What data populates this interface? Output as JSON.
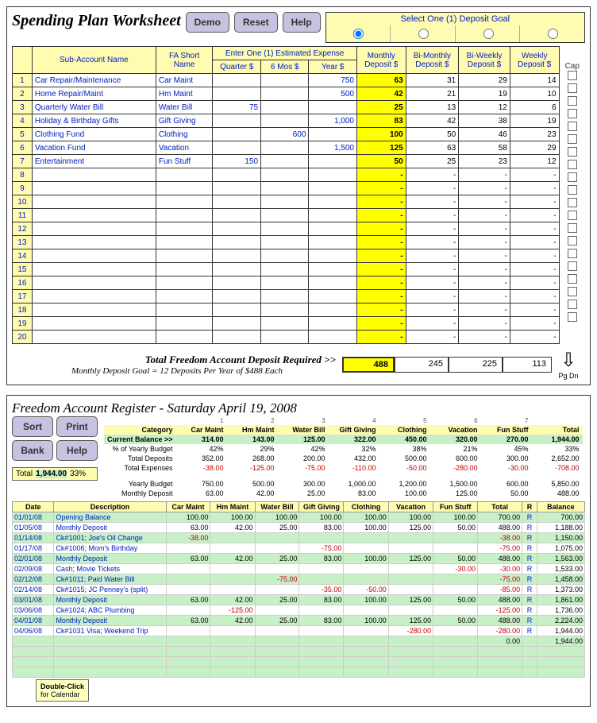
{
  "spending": {
    "title": "Spending Plan Worksheet",
    "demo": "Demo",
    "reset": "Reset",
    "help": "Help",
    "depgoal": "Select One (1) Deposit Goal",
    "hdr_sub": "Sub-Account Name",
    "hdr_fa": "FA Short Name",
    "hdr_exp": "Enter One (1) Estimated Expense",
    "hdr_q": "Quarter $",
    "hdr_6": "6 Mos $",
    "hdr_y": "Year $",
    "hdr_mon": "Monthly Deposit $",
    "hdr_bim": "Bi-Monthly Deposit $",
    "hdr_biw": "Bi-Weekly Deposit $",
    "hdr_wk": "Weekly Deposit $",
    "cap": "Cap",
    "rows": [
      {
        "n": "1",
        "name": "Car Repair/Maintenance",
        "fa": "Car Maint",
        "q": "",
        "s": "",
        "y": "750",
        "mon": "63",
        "bim": "31",
        "biw": "29",
        "wk": "14"
      },
      {
        "n": "2",
        "name": "Home Repair/Maint",
        "fa": "Hm Maint",
        "q": "",
        "s": "",
        "y": "500",
        "mon": "42",
        "bim": "21",
        "biw": "19",
        "wk": "10"
      },
      {
        "n": "3",
        "name": "Quarterly Water Bill",
        "fa": "Water Bill",
        "q": "75",
        "s": "",
        "y": "",
        "mon": "25",
        "bim": "13",
        "biw": "12",
        "wk": "6"
      },
      {
        "n": "4",
        "name": "Holiday & Birthday Gifts",
        "fa": "Gift Giving",
        "q": "",
        "s": "",
        "y": "1,000",
        "mon": "83",
        "bim": "42",
        "biw": "38",
        "wk": "19"
      },
      {
        "n": "5",
        "name": "Clothing Fund",
        "fa": "Clothing",
        "q": "",
        "s": "600",
        "y": "",
        "mon": "100",
        "bim": "50",
        "biw": "46",
        "wk": "23"
      },
      {
        "n": "6",
        "name": "Vacation Fund",
        "fa": "Vacation",
        "q": "",
        "s": "",
        "y": "1,500",
        "mon": "125",
        "bim": "63",
        "biw": "58",
        "wk": "29"
      },
      {
        "n": "7",
        "name": "Entertainment",
        "fa": "Fun Stuff",
        "q": "150",
        "s": "",
        "y": "",
        "mon": "50",
        "bim": "25",
        "biw": "23",
        "wk": "12"
      }
    ],
    "empty": [
      "8",
      "9",
      "10",
      "11",
      "12",
      "13",
      "14",
      "15",
      "16",
      "17",
      "18",
      "19",
      "20"
    ],
    "totreq": "Total Freedom Account Deposit Required  >>",
    "tot_mon": "488",
    "tot_bim": "245",
    "tot_biw": "225",
    "tot_wk": "113",
    "subtext": "Monthly Deposit Goal = 12 Deposits Per Year of $488 Each",
    "pgdn": "Pg Dn"
  },
  "register": {
    "title": "Freedom Account Register - Saturday April 19, 2008",
    "sort": "Sort",
    "print": "Print",
    "bank": "Bank",
    "help": "Help",
    "total_lbl": "Total",
    "total_val": "1,944.00",
    "total_pct": "33%",
    "lbl_cat": "Category",
    "lbl_cur": "Current Balance >>",
    "lbl_pct": "% of Yearly Budget",
    "lbl_td": "Total Deposits",
    "lbl_te": "Total Expenses",
    "lbl_yb": "Yearly Budget",
    "lbl_md": "Monthly Deposit",
    "cats": [
      "Car Maint",
      "Hm Maint",
      "Water Bill",
      "Gift Giving",
      "Clothing",
      "Vacation",
      "Fun Stuff",
      "Total"
    ],
    "catnums": [
      "1",
      "2",
      "3",
      "4",
      "5",
      "6",
      "7",
      ""
    ],
    "cur": [
      "314.00",
      "143.00",
      "125.00",
      "322.00",
      "450.00",
      "320.00",
      "270.00",
      "1,944.00"
    ],
    "pct": [
      "42%",
      "29%",
      "42%",
      "32%",
      "38%",
      "21%",
      "45%",
      "33%"
    ],
    "td": [
      "352.00",
      "268.00",
      "200.00",
      "432.00",
      "500.00",
      "600.00",
      "300.00",
      "2,652.00"
    ],
    "te": [
      "-38.00",
      "-125.00",
      "-75.00",
      "-110.00",
      "-50.00",
      "-280.00",
      "-30.00",
      "-708.00"
    ],
    "yb": [
      "750.00",
      "500.00",
      "300.00",
      "1,000.00",
      "1,200.00",
      "1,500.00",
      "600.00",
      "5,850.00"
    ],
    "md": [
      "63.00",
      "42.00",
      "25.00",
      "83.00",
      "100.00",
      "125.00",
      "50.00",
      "488.00"
    ],
    "h_date": "Date",
    "h_desc": "Description",
    "h_total": "Total",
    "h_r": "R",
    "h_bal": "Balance",
    "rows": [
      {
        "g": 1,
        "date": "01/01/08",
        "desc": "Opening Balance",
        "v": [
          "100.00",
          "100.00",
          "100.00",
          "100.00",
          "100.00",
          "100.00",
          "100.00"
        ],
        "tot": "700.00",
        "r": "R",
        "bal": "700.00"
      },
      {
        "g": 0,
        "date": "01/05/08",
        "desc": "Monthly Deposit",
        "v": [
          "63.00",
          "42.00",
          "25.00",
          "83.00",
          "100.00",
          "125.00",
          "50.00"
        ],
        "tot": "488.00",
        "r": "R",
        "bal": "1,188.00"
      },
      {
        "g": 1,
        "date": "01/14/08",
        "desc": "Ck#1001; Joe's Oil Change",
        "v": [
          "-38.00",
          "",
          "",
          "",
          "",
          "",
          ""
        ],
        "tot": "-38.00",
        "r": "R",
        "bal": "1,150.00"
      },
      {
        "g": 0,
        "date": "01/17/08",
        "desc": "Ck#1006; Mom's Birthday",
        "v": [
          "",
          "",
          "",
          "-75.00",
          "",
          "",
          ""
        ],
        "tot": "-75.00",
        "r": "R",
        "bal": "1,075.00"
      },
      {
        "g": 1,
        "date": "02/01/08",
        "desc": "Monthly Deposit",
        "v": [
          "63.00",
          "42.00",
          "25.00",
          "83.00",
          "100.00",
          "125.00",
          "50.00"
        ],
        "tot": "488.00",
        "r": "R",
        "bal": "1,563.00"
      },
      {
        "g": 0,
        "date": "02/09/08",
        "desc": "Cash; Movie Tickets",
        "v": [
          "",
          "",
          "",
          "",
          "",
          "",
          "-30.00"
        ],
        "tot": "-30.00",
        "r": "R",
        "bal": "1,533.00"
      },
      {
        "g": 1,
        "date": "02/12/08",
        "desc": "Ck#1011; Paid Water Bill",
        "v": [
          "",
          "",
          "-75.00",
          "",
          "",
          "",
          ""
        ],
        "tot": "-75.00",
        "r": "R",
        "bal": "1,458.00"
      },
      {
        "g": 0,
        "date": "02/14/08",
        "desc": "Ck#1015; JC Penney's (split)",
        "v": [
          "",
          "",
          "",
          "-35.00",
          "-50.00",
          "",
          ""
        ],
        "tot": "-85.00",
        "r": "R",
        "bal": "1,373.00"
      },
      {
        "g": 1,
        "date": "03/01/08",
        "desc": "Monthly Deposit",
        "v": [
          "63.00",
          "42.00",
          "25.00",
          "83.00",
          "100.00",
          "125.00",
          "50.00"
        ],
        "tot": "488.00",
        "r": "R",
        "bal": "1,861.00"
      },
      {
        "g": 0,
        "date": "03/06/08",
        "desc": "Ck#1024; ABC Plumbing",
        "v": [
          "",
          "-125.00",
          "",
          "",
          "",
          "",
          ""
        ],
        "tot": "-125.00",
        "r": "R",
        "bal": "1,736.00"
      },
      {
        "g": 1,
        "date": "04/01/08",
        "desc": "Monthly Deposit",
        "v": [
          "63.00",
          "42.00",
          "25.00",
          "83.00",
          "100.00",
          "125.00",
          "50.00"
        ],
        "tot": "488.00",
        "r": "R",
        "bal": "2,224.00"
      },
      {
        "g": 0,
        "date": "04/06/08",
        "desc": "Ck#1031 Visa; Weekend Trip",
        "v": [
          "",
          "",
          "",
          "",
          "",
          "-280.00",
          ""
        ],
        "tot": "-280.00",
        "r": "R",
        "bal": "1,944.00"
      },
      {
        "g": 1,
        "date": "",
        "desc": "",
        "v": [
          "",
          "",
          "",
          "",
          "",
          "",
          ""
        ],
        "tot": "0.00",
        "r": "",
        "bal": "1,944.00"
      }
    ],
    "tooltip1": "Double-Click",
    "tooltip2": "for Calendar"
  }
}
